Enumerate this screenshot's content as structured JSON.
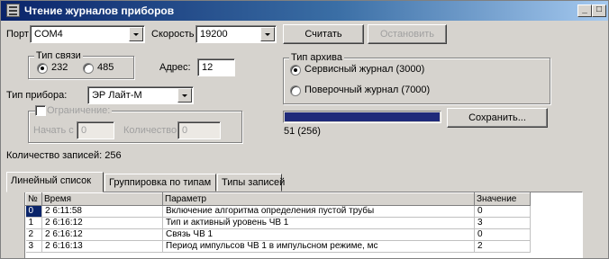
{
  "window": {
    "title": "Чтение журналов приборов",
    "controls": {
      "minimize": "_",
      "maximize": "□"
    }
  },
  "port": {
    "label": "Порт",
    "value": "COM4"
  },
  "speed": {
    "label": "Скорость",
    "value": "19200"
  },
  "buttons": {
    "read": "Считать",
    "stop": "Остановить",
    "save": "Сохранить..."
  },
  "link_type": {
    "legend": "Тип связи",
    "options": [
      {
        "label": "232",
        "checked": true
      },
      {
        "label": "485",
        "checked": false
      }
    ]
  },
  "address": {
    "label": "Адрес:",
    "value": "12"
  },
  "device_type": {
    "label": "Тип прибора:",
    "value": "ЭР Лайт-М"
  },
  "limit": {
    "legend": "Ограничение:",
    "checked": false,
    "start_label": "Начать с",
    "start_value": "0",
    "count_label": "Количество",
    "count_value": "0"
  },
  "archive_type": {
    "legend": "Тип архива",
    "options": [
      {
        "label": "Сервисный журнал (3000)",
        "checked": true
      },
      {
        "label": "Поверочный журнал (7000)",
        "checked": false
      }
    ]
  },
  "progress": {
    "fraction": 1.0,
    "text": "51 (256)",
    "fill_color": "#1f2a7a"
  },
  "record_count": "Количество записей: 256",
  "tabs": [
    {
      "label": "Линейный список",
      "active": true
    },
    {
      "label": "Группировка по типам",
      "active": false
    },
    {
      "label": "Типы записей",
      "active": false
    }
  ],
  "table": {
    "columns": [
      "№",
      "Время",
      "Параметр",
      "Значение"
    ],
    "rows": [
      [
        "0",
        "2 6:11:58",
        "Включение алгоритма определения пустой трубы",
        "0"
      ],
      [
        "1",
        "2 6:16:12",
        "Тип и активный уровень ЧВ 1",
        "3"
      ],
      [
        "2",
        "2 6:16:12",
        "Связь ЧВ 1",
        "0"
      ],
      [
        "3",
        "2 6:16:13",
        "Период импульсов ЧВ 1 в импульсном режиме, мс",
        "2"
      ]
    ],
    "selected_row": 0
  },
  "colors": {
    "title_gradient_start": "#0a246a",
    "title_gradient_end": "#a6caf0",
    "face": "#d6d3ce",
    "selection": "#0a246a"
  }
}
